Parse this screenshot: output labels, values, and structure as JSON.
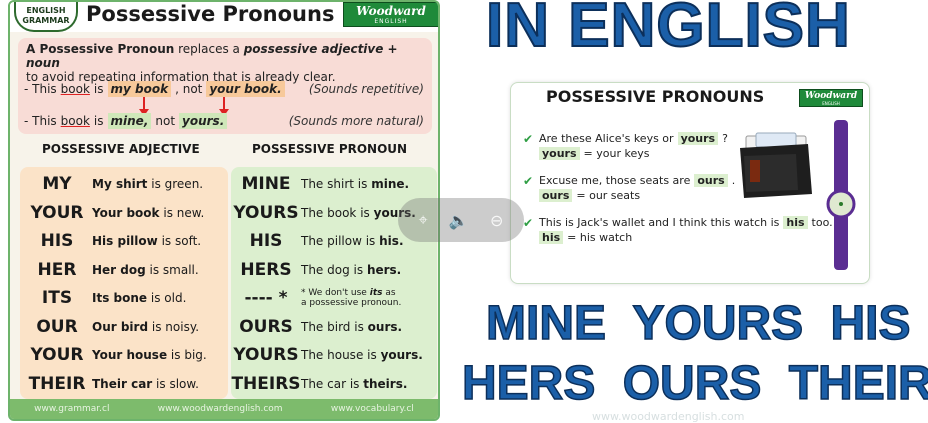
{
  "left_panel": {
    "badge": {
      "line1": "ENGLISH",
      "line2": "GRAMMAR"
    },
    "title": "Possessive Pronouns",
    "logo": {
      "name": "Woodward",
      "sub": "ENGLISH"
    },
    "explain": {
      "p1": "A Possessive Pronoun",
      "p2": "replaces a",
      "p3": "possessive adjective + noun",
      "p4": "to avoid repeating information that is already clear."
    },
    "example1": {
      "lead": "- This",
      "u": "book",
      "is": "is",
      "hl1": "my book",
      "not": ", not",
      "hl2": "your book.",
      "note": "(Sounds repetitive)"
    },
    "example2": {
      "lead": "- This",
      "u": "book",
      "is": "is",
      "hl1": "mine,",
      "not": "not",
      "hl2": "yours.",
      "note": "(Sounds more natural)"
    },
    "col_adj": "POSSESSIVE ADJECTIVE",
    "col_pro": "POSSESSIVE PRONOUN",
    "rows": [
      {
        "adj": "MY",
        "adj_b": "My shirt",
        "adj_r": "is green.",
        "pro": "MINE",
        "pro_s": "The shirt is",
        "pro_b": "mine."
      },
      {
        "adj": "YOUR",
        "adj_b": "Your book",
        "adj_r": "is new.",
        "pro": "YOURS",
        "pro_s": "The book is",
        "pro_b": "yours."
      },
      {
        "adj": "HIS",
        "adj_b": "His pillow",
        "adj_r": "is soft.",
        "pro": "HIS",
        "pro_s": "The pillow is",
        "pro_b": "his."
      },
      {
        "adj": "HER",
        "adj_b": "Her dog",
        "adj_r": "is small.",
        "pro": "HERS",
        "pro_s": "The dog is",
        "pro_b": "hers."
      },
      {
        "adj": "ITS",
        "adj_b": "Its bone",
        "adj_r": "is old.",
        "pro": "---- *",
        "pro_s": "",
        "pro_b": ""
      },
      {
        "adj": "OUR",
        "adj_b": "Our bird",
        "adj_r": "is noisy.",
        "pro": "OURS",
        "pro_s": "The bird is",
        "pro_b": "ours."
      },
      {
        "adj": "YOUR",
        "adj_b": "Your house",
        "adj_r": "is big.",
        "pro": "YOURS",
        "pro_s": "The house is",
        "pro_b": "yours."
      },
      {
        "adj": "THEIR",
        "adj_b": "Their car",
        "adj_r": "is slow.",
        "pro": "THEIRS",
        "pro_s": "The car is",
        "pro_b": "theirs."
      }
    ],
    "its_note": {
      "l1a": "* We don't use",
      "l1b": "its",
      "l1c": "as",
      "l2": "a possessive pronoun."
    },
    "footer": [
      "www.grammar.cl",
      "www.woodwardenglish.com",
      "www.vocabulary.cl"
    ]
  },
  "right": {
    "big_title": "IN ENGLISH",
    "card": {
      "title": "POSSESSIVE PRONOUNS",
      "logo": {
        "name": "Woodward",
        "sub": "ENGLISH"
      },
      "q1": {
        "a": "Are these Alice's keys or",
        "chip": "yours",
        "end": "?",
        "chip2": "yours",
        "b": "= your keys"
      },
      "q2": {
        "a": "Excuse me, those seats are",
        "chip": "ours",
        "end": ".",
        "chip2": "ours",
        "b": "= our seats"
      },
      "q3": {
        "a": "This is Jack's wallet and I think this watch is",
        "chip": "his",
        "end": "too.",
        "chip2": "his",
        "b": "= his watch"
      }
    },
    "line1": "MINE YOURS HIS",
    "line2": "HERS OURS THEIRS",
    "footer": "www.woodwardenglish.com"
  },
  "colors": {
    "brand_blue": "#1b5fa8",
    "green": "#1f8a3a",
    "adj_bg": "#fbe3c8",
    "pro_bg": "#dcefcf"
  }
}
